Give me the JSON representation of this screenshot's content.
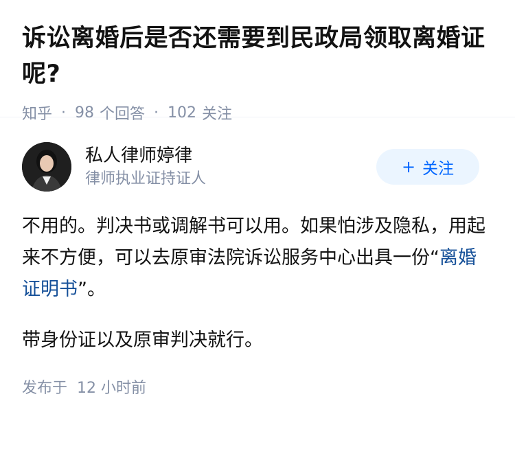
{
  "question": {
    "title": "诉讼离婚后是否还需要到民政局领取离婚证呢?",
    "source": "知乎",
    "answer_count": "98",
    "answer_label": "个回答",
    "follower_count": "102",
    "follower_label": "关注"
  },
  "answer": {
    "author_name": "私人律师婷律",
    "author_badge": "律师执业证持证人",
    "follow_label": "关注",
    "follow_plus": "+",
    "para1_before": "不用的。判决书或调解书可以用。如果怕涉及隐私，用起来不方便，可以去原审法院诉讼服务中心出具一份“",
    "para1_link": "离婚证明书",
    "para1_after": "”。",
    "para2": "带身份证以及原审判决就行。",
    "publish_prefix": "发布于",
    "publish_time": "12 小时前"
  },
  "colors": {
    "link": "#175199",
    "follow_bg": "#ebf5ff",
    "follow_text": "#0066ff",
    "meta": "#8590a6"
  }
}
